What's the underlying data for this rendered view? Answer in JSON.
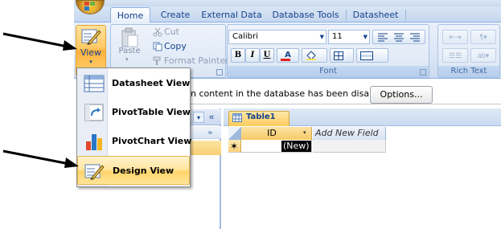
{
  "ribbon": {
    "tabs": [
      "Home",
      "Create",
      "External Data",
      "Database Tools",
      "Datasheet"
    ],
    "active_tab": "Home",
    "views_group": {
      "view_label": "View",
      "chevron": "▾"
    },
    "clipboard_group": {
      "paste_label": "Paste",
      "paste_chevron": "▾",
      "cut_label": "Cut",
      "copy_label": "Copy",
      "format_painter_label": "Format Painter"
    },
    "font_group": {
      "font_name": "Calibri",
      "font_size": "11",
      "label": "Font",
      "bold": "B",
      "italic": "I",
      "underline": "U",
      "font_color_letter": "A"
    },
    "rich_text_group": {
      "label": "Rich Text"
    }
  },
  "message_bar": {
    "text": "n content in the database has been disabled",
    "options_button": "Options..."
  },
  "nav_pane": {
    "dropdown_glyph": "▾",
    "collapse_glyph": "«",
    "group_chevron": "≈"
  },
  "document": {
    "tab_label": "Table1",
    "columns": [
      "ID",
      "Add New Field"
    ],
    "new_row_marker": "✶",
    "new_row_value": "(New)"
  },
  "view_menu": {
    "items": [
      {
        "label": "Datasheet View",
        "selected": false
      },
      {
        "label": "PivotTable View",
        "selected": false
      },
      {
        "label": "PivotChart View",
        "selected": false
      },
      {
        "label": "Design View",
        "selected": true
      }
    ]
  },
  "colors": {
    "ribbon_text": "#15428b",
    "highlight": "#ffd56b",
    "ribbon_bg": "#dbe6f5"
  }
}
